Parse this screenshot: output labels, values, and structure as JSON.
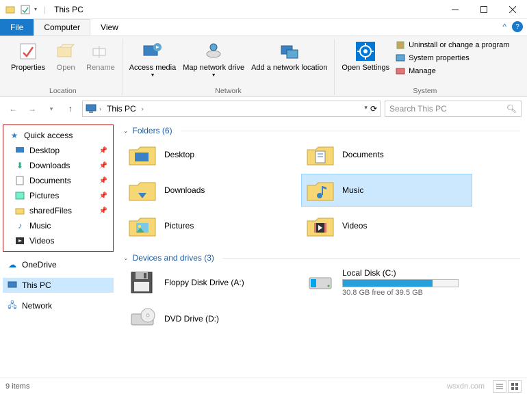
{
  "titlebar": {
    "title": "This PC"
  },
  "tabs": {
    "file": "File",
    "computer": "Computer",
    "view": "View"
  },
  "ribbon": {
    "properties": "Properties",
    "open": "Open",
    "rename": "Rename",
    "access_media": "Access media",
    "map_network_drive": "Map network drive",
    "add_network_location": "Add a network location",
    "open_settings": "Open Settings",
    "uninstall": "Uninstall or change a program",
    "system_props": "System properties",
    "manage": "Manage",
    "group_location": "Location",
    "group_network": "Network",
    "group_system": "System"
  },
  "address": {
    "location": "This PC",
    "search_placeholder": "Search This PC"
  },
  "nav": {
    "quick_access": "Quick access",
    "items": [
      {
        "label": "Desktop",
        "pinned": true
      },
      {
        "label": "Downloads",
        "pinned": true
      },
      {
        "label": "Documents",
        "pinned": true
      },
      {
        "label": "Pictures",
        "pinned": true
      },
      {
        "label": "sharedFiles",
        "pinned": true
      },
      {
        "label": "Music",
        "pinned": false
      },
      {
        "label": "Videos",
        "pinned": false
      }
    ],
    "onedrive": "OneDrive",
    "thispc": "This PC",
    "network": "Network"
  },
  "content": {
    "folders_header": "Folders (6)",
    "folders": [
      {
        "label": "Desktop"
      },
      {
        "label": "Documents"
      },
      {
        "label": "Downloads"
      },
      {
        "label": "Music",
        "selected": true
      },
      {
        "label": "Pictures"
      },
      {
        "label": "Videos"
      }
    ],
    "devices_header": "Devices and drives (3)",
    "devices": [
      {
        "label": "Floppy Disk Drive (A:)",
        "type": "floppy"
      },
      {
        "label": "Local Disk (C:)",
        "type": "disk",
        "free": "30.8 GB free of 39.5 GB",
        "fill_pct": 78
      },
      {
        "label": "DVD Drive (D:)",
        "type": "dvd"
      }
    ]
  },
  "status": {
    "items": "9 items"
  },
  "watermark": "wsxdn.com"
}
